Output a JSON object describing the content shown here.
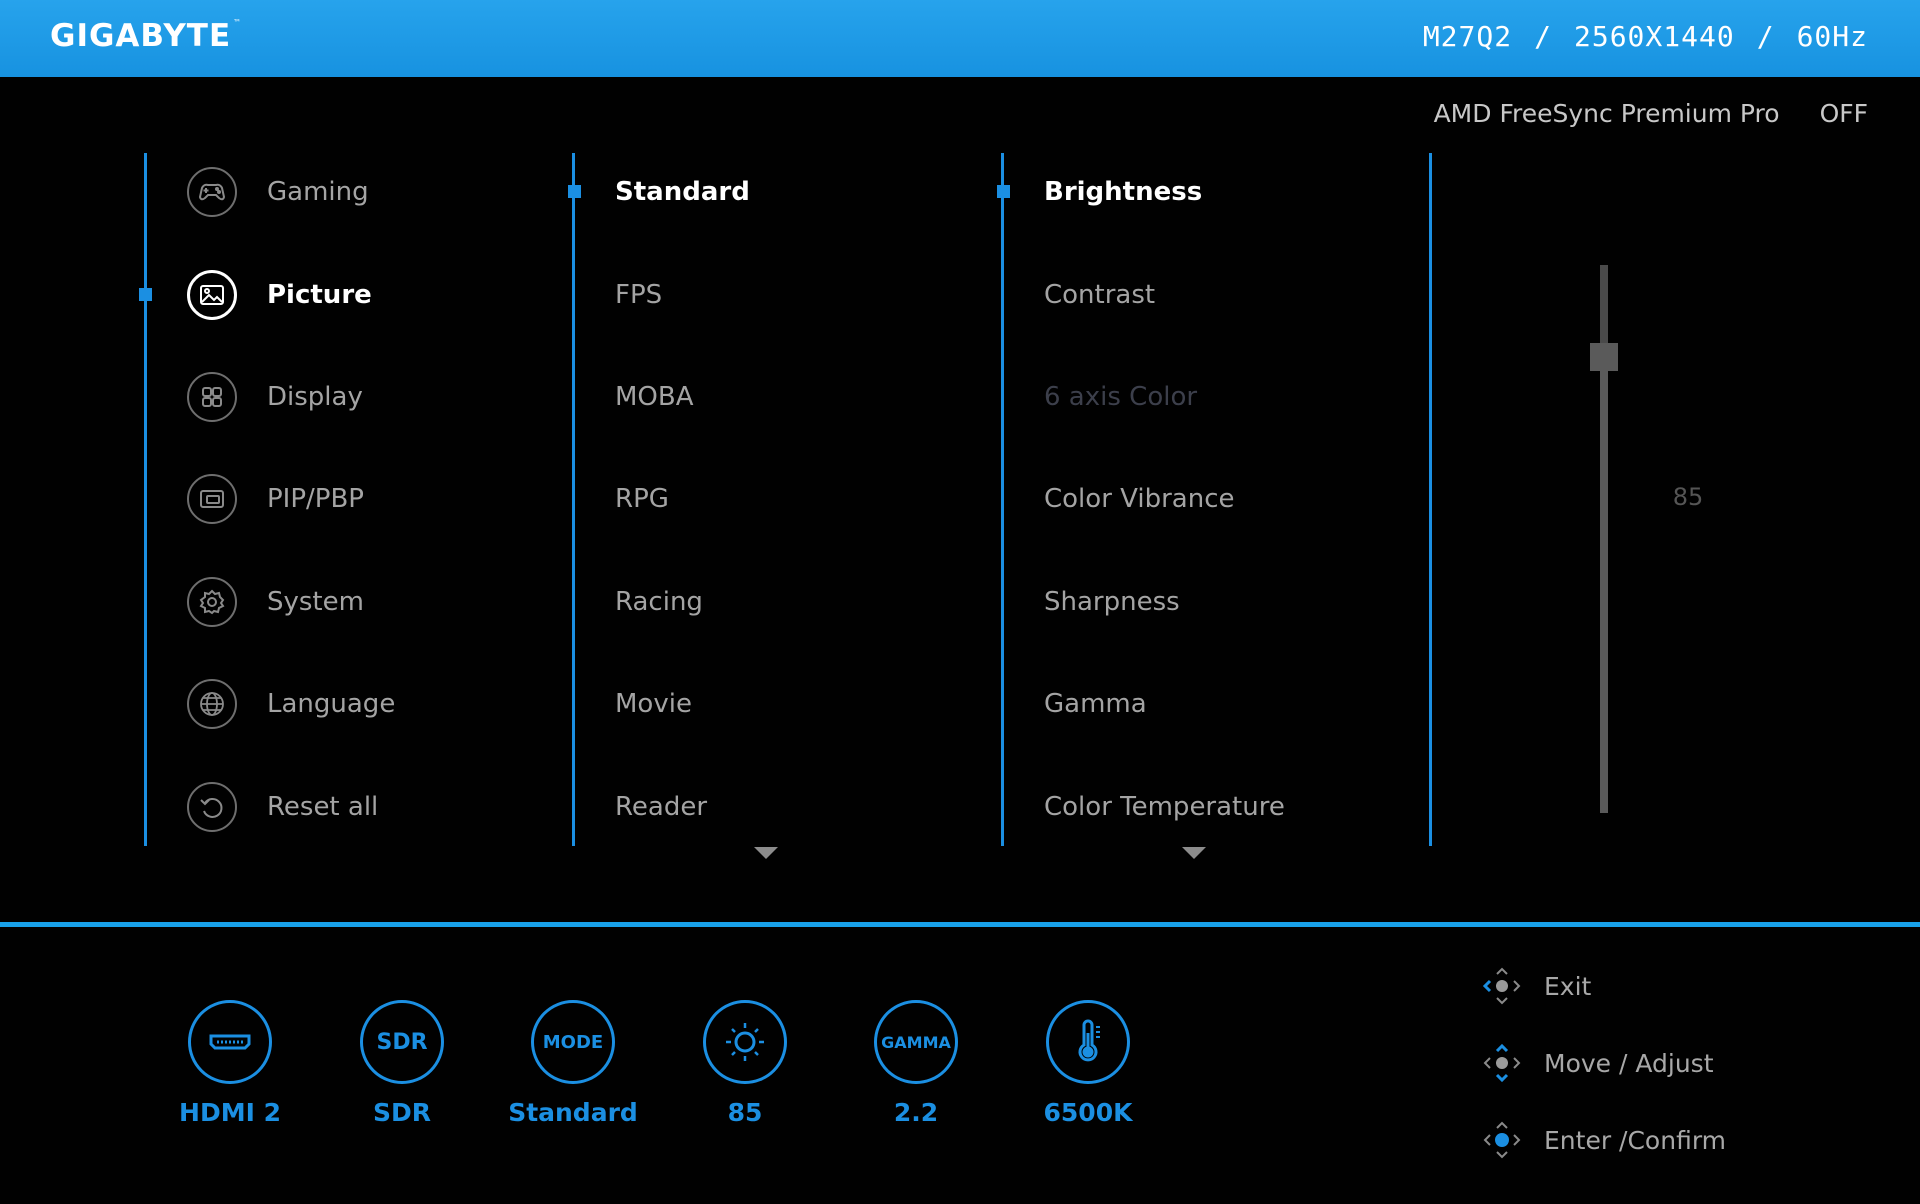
{
  "header": {
    "brand": "GIGABYTE",
    "brand_tm": "™",
    "model": "M27Q2",
    "sep1": "/",
    "resolution": "2560X1440",
    "sep2": "/",
    "refresh": "60Hz"
  },
  "freesync": {
    "label": "AMD FreeSync Premium Pro",
    "value": "OFF"
  },
  "main_menu": [
    {
      "label": "Gaming",
      "icon": "gamepad-icon"
    },
    {
      "label": "Picture",
      "icon": "picture-icon",
      "active": true
    },
    {
      "label": "Display",
      "icon": "display-icon"
    },
    {
      "label": "PIP/PBP",
      "icon": "pip-icon"
    },
    {
      "label": "System",
      "icon": "gear-icon"
    },
    {
      "label": "Language",
      "icon": "globe-icon"
    },
    {
      "label": "Reset all",
      "icon": "reset-icon"
    }
  ],
  "picture_modes": [
    {
      "label": "Standard",
      "active": true
    },
    {
      "label": "FPS"
    },
    {
      "label": "MOBA"
    },
    {
      "label": "RPG"
    },
    {
      "label": "Racing"
    },
    {
      "label": "Movie"
    },
    {
      "label": "Reader"
    }
  ],
  "settings": [
    {
      "label": "Brightness",
      "active": true
    },
    {
      "label": "Contrast"
    },
    {
      "label": "6 axis Color",
      "disabled": true
    },
    {
      "label": "Color Vibrance"
    },
    {
      "label": "Sharpness"
    },
    {
      "label": "Gamma"
    },
    {
      "label": "Color Temperature"
    }
  ],
  "slider": {
    "value": "85",
    "fraction": 0.85
  },
  "status_bar": [
    {
      "label": "HDMI 2",
      "icon": "hdmi-icon"
    },
    {
      "label": "SDR",
      "icon_text": "SDR"
    },
    {
      "label": "Standard",
      "icon_text": "MODE"
    },
    {
      "label": "85",
      "icon": "brightness-icon"
    },
    {
      "label": "2.2",
      "icon_text": "GAMMA"
    },
    {
      "label": "6500K",
      "icon": "thermometer-icon"
    }
  ],
  "hints": [
    {
      "label": "Exit",
      "icon": "joystick-left-icon"
    },
    {
      "label": "Move / Adjust",
      "icon": "joystick-updown-icon"
    },
    {
      "label": "Enter /Confirm",
      "icon": "joystick-press-icon"
    }
  ],
  "colors": {
    "accent": "#1B8FE2",
    "header": "#1F9BE6"
  }
}
